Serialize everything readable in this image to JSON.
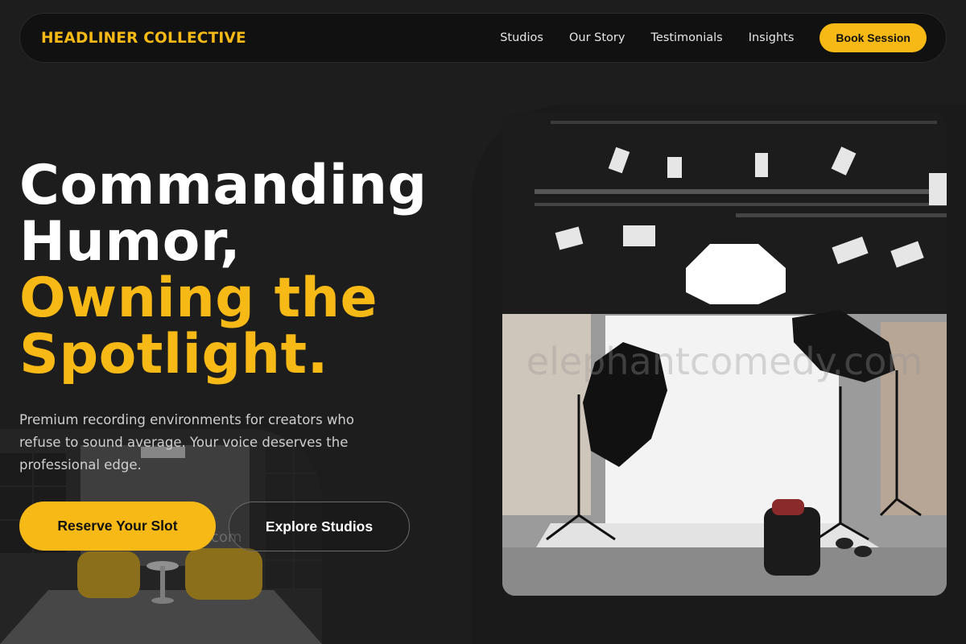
{
  "nav": {
    "brand": "HEADLINER COLLECTIVE",
    "links": [
      "Studios",
      "Our Story",
      "Testimonials",
      "Insights"
    ],
    "cta": "Book Session"
  },
  "hero": {
    "title_line1": "Commanding",
    "title_line2": "Humor,",
    "title_line3": "Owning the",
    "title_line4": "Spotlight.",
    "subtitle": "Premium recording environments for creators who refuse to sound average. Your voice deserves the professional edge.",
    "primary_button": "Reserve Your Slot",
    "secondary_button": "Explore Studios"
  },
  "images": {
    "studio_watermark": "elephantcomedy.com",
    "lounge_watermark": "com"
  },
  "colors": {
    "accent": "#f7b916",
    "background": "#1d1d1d",
    "nav_background": "#111111"
  }
}
